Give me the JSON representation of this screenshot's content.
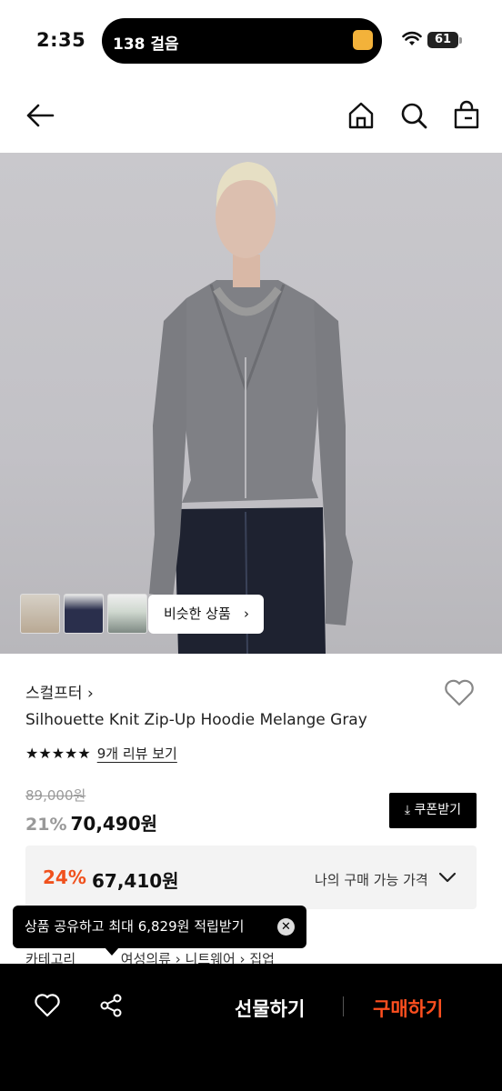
{
  "status_bar": {
    "time": "2:35",
    "activity": "138 걸음",
    "battery": "61"
  },
  "product": {
    "brand": "스컬프터",
    "title": "Silhouette Knit Zip-Up Hoodie Melange Gray",
    "rating_stars": "★★★★★",
    "review_link": "9개 리뷰 보기",
    "original_price": "89,000원",
    "discount_rate": "21%",
    "sale_price": "70,490원",
    "coupon_label": "쿠폰받기",
    "my_price": {
      "discount_rate": "24%",
      "price": "67,410원",
      "label": "나의 구매 가능 가격"
    }
  },
  "hero": {
    "similar_label": "비슷한 상품"
  },
  "tooltip": {
    "text": "상품 공유하고 최대 6,829원 적립받기"
  },
  "breadcrumb": {
    "label": "카테고리",
    "items": [
      "여성의류",
      "니트웨어",
      "집업"
    ]
  },
  "bottom_bar": {
    "gift_label": "선물하기",
    "buy_label": "구매하기"
  },
  "colors": {
    "accent": "#f0511d",
    "buy": "#ff4f1f",
    "dark": "#000000"
  }
}
